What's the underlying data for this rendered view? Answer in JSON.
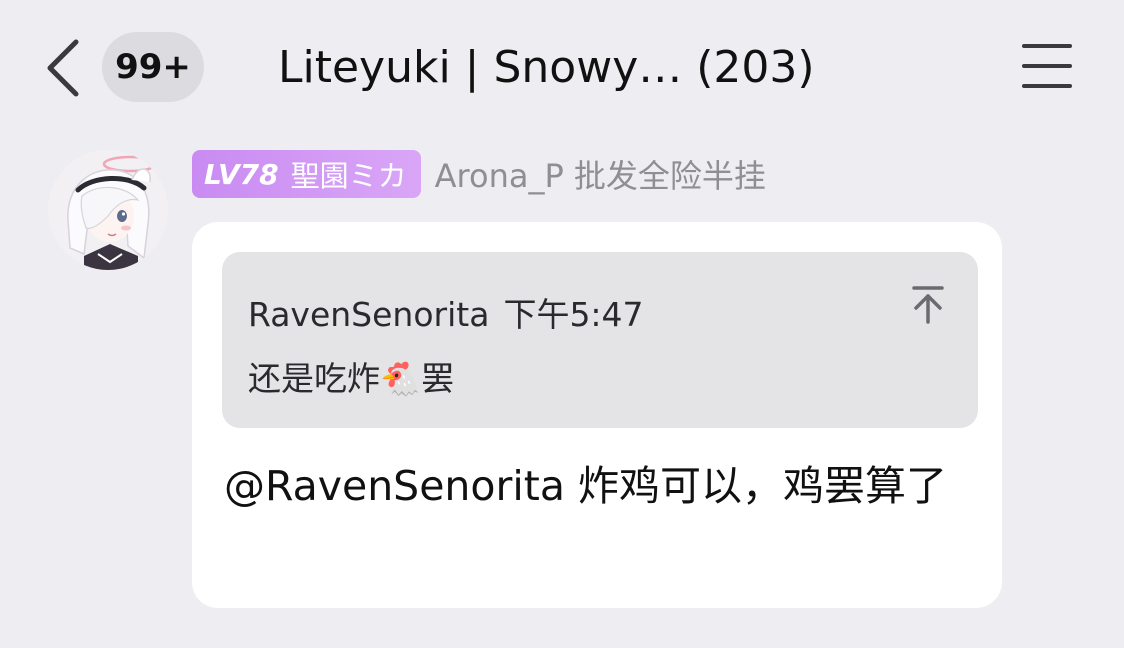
{
  "header": {
    "back_icon": "chevron-left-icon",
    "unread_badge": "99+",
    "title": "Liteyuki | Snowy… (203)",
    "menu_icon": "hamburger-menu-icon"
  },
  "message": {
    "avatar_icon": "anime-girl-avatar",
    "level": "LV78",
    "level_title": "聖園ミカ",
    "sender_name": "Arona_P 批发全险半挂",
    "quote": {
      "author": "RavenSenorita",
      "time": "下午5:47",
      "text_before_emoji": "还是吃炸",
      "emoji": "🐔",
      "text_after_emoji": "罢",
      "jump_icon": "jump-to-top-icon"
    },
    "text": "@RavenSenorita 炸鸡可以，鸡罢算了"
  },
  "colors": {
    "background": "#eeeef2",
    "bubble": "#ffffff",
    "quote_background": "#e4e4e6",
    "level_tag": "#d19af5",
    "secondary_text": "#8e8e94"
  }
}
